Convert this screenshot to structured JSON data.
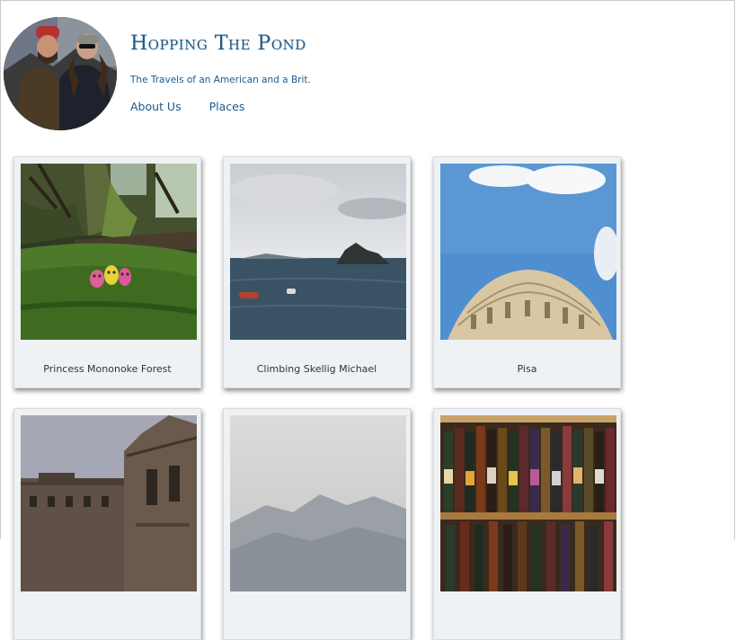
{
  "header": {
    "title": "Hopping The Pond",
    "tagline": "The Travels of an American and a Brit.",
    "nav": [
      {
        "label": "About Us"
      },
      {
        "label": "Places"
      }
    ]
  },
  "gallery": {
    "cards": [
      {
        "caption": "Princess Mononoke Forest"
      },
      {
        "caption": "Climbing Skellig Michael"
      },
      {
        "caption": "Pisa"
      },
      {
        "caption": ""
      },
      {
        "caption": ""
      },
      {
        "caption": ""
      }
    ]
  },
  "colors": {
    "link": "#1a5a8c",
    "card_background": "#eff2f5",
    "caption_text": "#333333"
  }
}
